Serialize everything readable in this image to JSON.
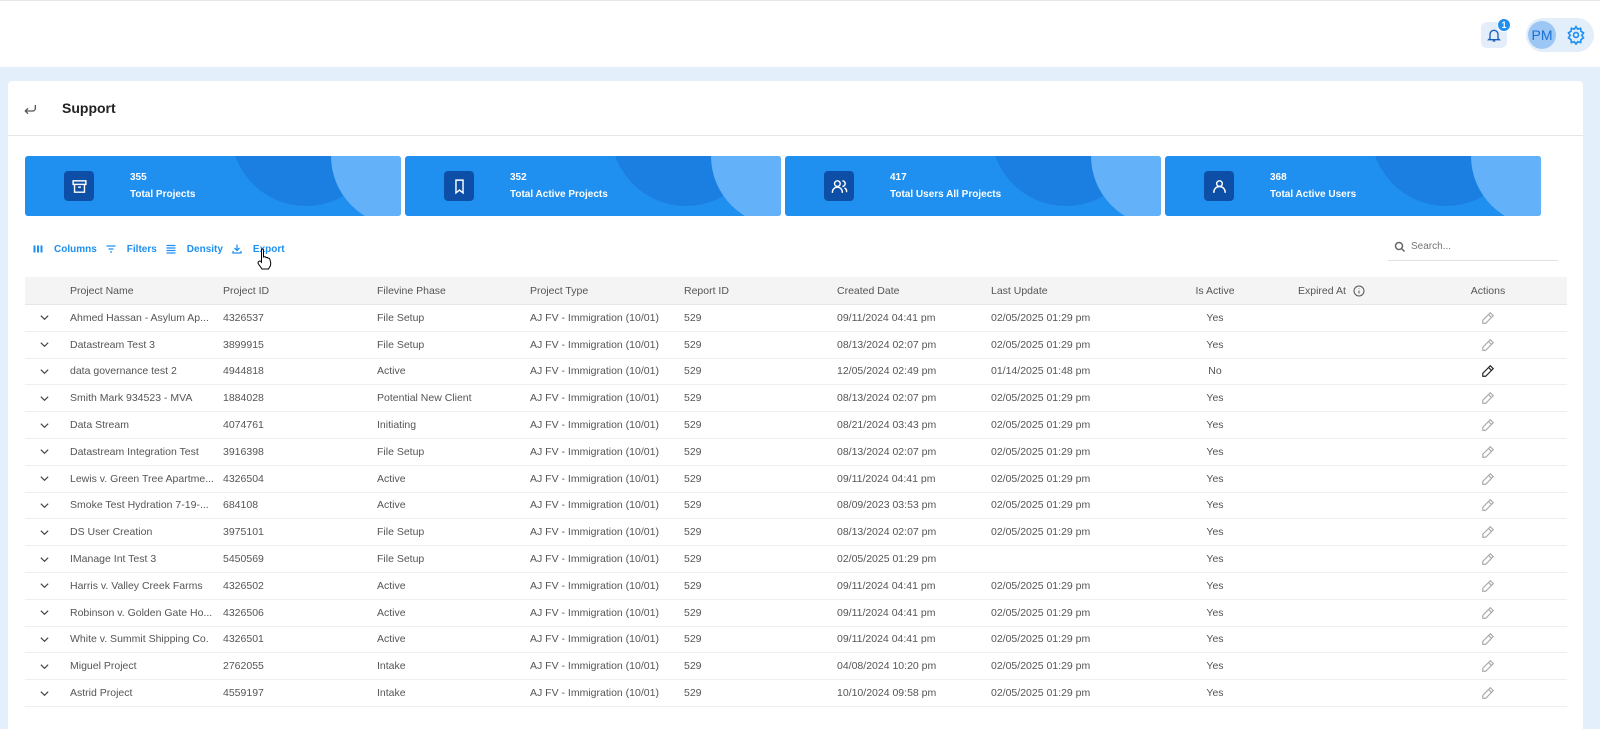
{
  "header": {
    "notification_count": "1",
    "avatar_initials": "PM",
    "page_title": "Support"
  },
  "stats": [
    {
      "value": "355",
      "label": "Total Projects",
      "icon": "archive-icon"
    },
    {
      "value": "352",
      "label": "Total Active Projects",
      "icon": "bookmark-icon"
    },
    {
      "value": "417",
      "label": "Total Users All Projects",
      "icon": "users-icon"
    },
    {
      "value": "368",
      "label": "Total Active Users",
      "icon": "user-icon"
    }
  ],
  "toolbar": {
    "columns_label": "Columns",
    "filters_label": "Filters",
    "density_label": "Density",
    "export_label": "Export",
    "search_placeholder": "Search..."
  },
  "table": {
    "columns": [
      "Project Name",
      "Project ID",
      "Filevine Phase",
      "Project Type",
      "Report ID",
      "Created Date",
      "Last Update",
      "Is Active",
      "Expired At",
      "Actions"
    ],
    "rows": [
      [
        "Ahmed Hassan - Asylum Ap...",
        "4326537",
        "File Setup",
        "AJ FV - Immigration (10/01)",
        "529",
        "09/11/2024 04:41 pm",
        "02/05/2025 01:29 pm",
        "Yes",
        ""
      ],
      [
        "Datastream Test 3",
        "3899915",
        "File Setup",
        "AJ FV - Immigration (10/01)",
        "529",
        "08/13/2024 02:07 pm",
        "02/05/2025 01:29 pm",
        "Yes",
        ""
      ],
      [
        "data governance test 2",
        "4944818",
        "Active",
        "AJ FV - Immigration (10/01)",
        "529",
        "12/05/2024 02:49 pm",
        "01/14/2025 01:48 pm",
        "No",
        ""
      ],
      [
        "Smith Mark 934523 - MVA",
        "1884028",
        "Potential New Client",
        "AJ FV - Immigration (10/01)",
        "529",
        "08/13/2024 02:07 pm",
        "02/05/2025 01:29 pm",
        "Yes",
        ""
      ],
      [
        "Data Stream",
        "4074761",
        "Initiating",
        "AJ FV - Immigration (10/01)",
        "529",
        "08/21/2024 03:43 pm",
        "02/05/2025 01:29 pm",
        "Yes",
        ""
      ],
      [
        "Datastream Integration Test",
        "3916398",
        "File Setup",
        "AJ FV - Immigration (10/01)",
        "529",
        "08/13/2024 02:07 pm",
        "02/05/2025 01:29 pm",
        "Yes",
        ""
      ],
      [
        "Lewis v. Green Tree Apartme...",
        "4326504",
        "Active",
        "AJ FV - Immigration (10/01)",
        "529",
        "09/11/2024 04:41 pm",
        "02/05/2025 01:29 pm",
        "Yes",
        ""
      ],
      [
        "Smoke Test Hydration 7-19-...",
        "684108",
        "Active",
        "AJ FV - Immigration (10/01)",
        "529",
        "08/09/2023 03:53 pm",
        "02/05/2025 01:29 pm",
        "Yes",
        ""
      ],
      [
        "DS User Creation",
        "3975101",
        "File Setup",
        "AJ FV - Immigration (10/01)",
        "529",
        "08/13/2024 02:07 pm",
        "02/05/2025 01:29 pm",
        "Yes",
        ""
      ],
      [
        "IManage Int Test 3",
        "5450569",
        "File Setup",
        "AJ FV - Immigration (10/01)",
        "529",
        "02/05/2025 01:29 pm",
        "",
        "Yes",
        ""
      ],
      [
        "Harris v. Valley Creek Farms",
        "4326502",
        "Active",
        "AJ FV - Immigration (10/01)",
        "529",
        "09/11/2024 04:41 pm",
        "02/05/2025 01:29 pm",
        "Yes",
        ""
      ],
      [
        "Robinson v. Golden Gate Ho...",
        "4326506",
        "Active",
        "AJ FV - Immigration (10/01)",
        "529",
        "09/11/2024 04:41 pm",
        "02/05/2025 01:29 pm",
        "Yes",
        ""
      ],
      [
        "White v. Summit Shipping Co.",
        "4326501",
        "Active",
        "AJ FV - Immigration (10/01)",
        "529",
        "09/11/2024 04:41 pm",
        "02/05/2025 01:29 pm",
        "Yes",
        ""
      ],
      [
        "Miguel Project",
        "2762055",
        "Intake",
        "AJ FV - Immigration (10/01)",
        "529",
        "04/08/2024 10:20 pm",
        "02/05/2025 01:29 pm",
        "Yes",
        ""
      ],
      [
        "Astrid Project",
        "4559197",
        "Intake",
        "AJ FV - Immigration (10/01)",
        "529",
        "10/10/2024 09:58 pm",
        "02/05/2025 01:29 pm",
        "Yes",
        ""
      ]
    ]
  },
  "colors": {
    "accent": "#1f8ff0",
    "card_icon_bg": "#0d4fa6",
    "frame_bg": "#e3f0fb"
  }
}
